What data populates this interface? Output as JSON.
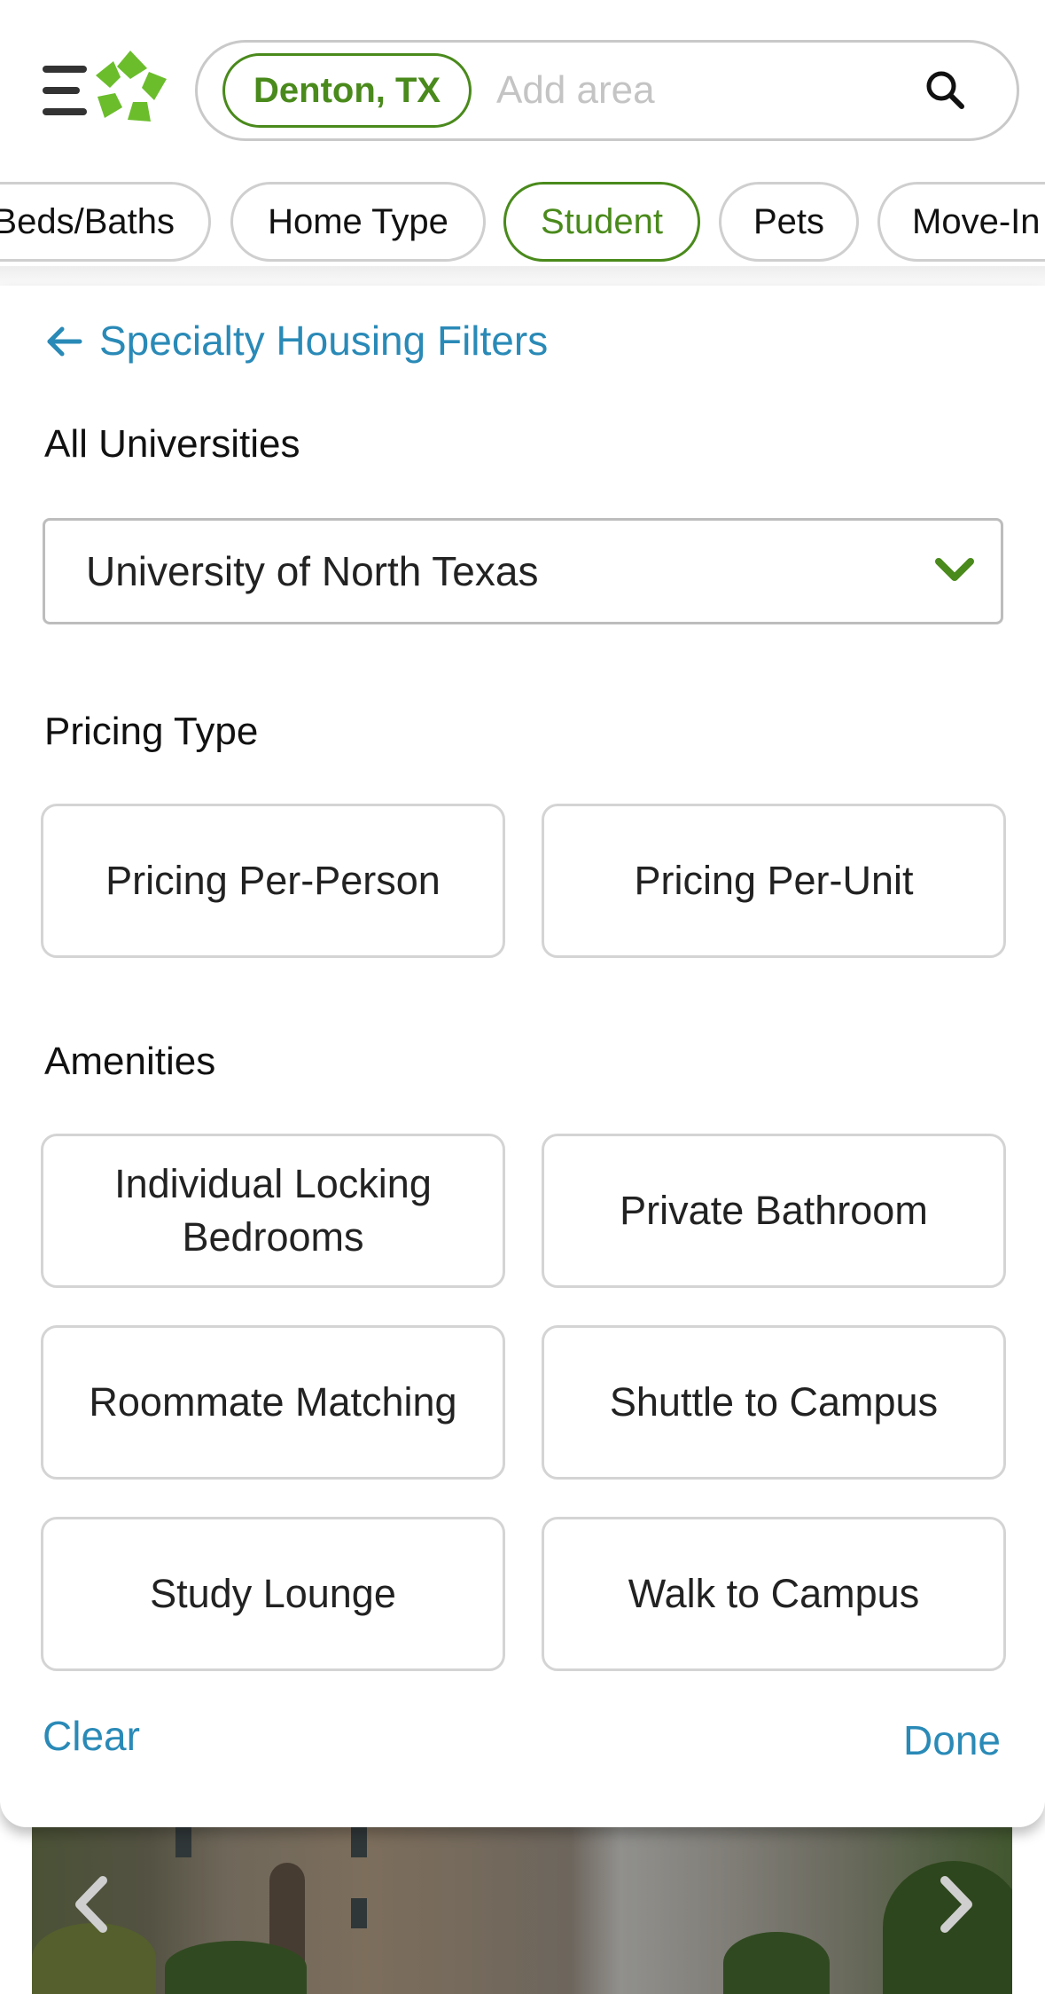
{
  "header": {
    "location_chip": "Denton, TX",
    "search_placeholder": "Add area",
    "colors": {
      "brand_green": "#4a8a1c",
      "link_blue": "#2a8ab7"
    }
  },
  "filter_chips": [
    {
      "label": "Beds/Baths",
      "active": false
    },
    {
      "label": "Home Type",
      "active": false
    },
    {
      "label": "Student",
      "active": true
    },
    {
      "label": "Pets",
      "active": false
    },
    {
      "label": "Move-In",
      "active": false
    }
  ],
  "panel": {
    "back_link": "Specialty Housing Filters",
    "universities": {
      "title": "All Universities",
      "selected": "University of North Texas"
    },
    "pricing": {
      "title": "Pricing Type",
      "options": [
        "Pricing Per-Person",
        "Pricing Per-Unit"
      ]
    },
    "amenities": {
      "title": "Amenities",
      "options": [
        "Individual Locking Bedrooms",
        "Private Bathroom",
        "Roommate Matching",
        "Shuttle to Campus",
        "Study Lounge",
        "Walk to Campus"
      ]
    },
    "clear_label": "Clear",
    "done_label": "Done"
  },
  "icons": [
    "menu-icon",
    "logo-icon",
    "search-icon",
    "back-arrow-icon",
    "chevron-down-icon",
    "chevron-left-icon",
    "chevron-right-icon"
  ]
}
